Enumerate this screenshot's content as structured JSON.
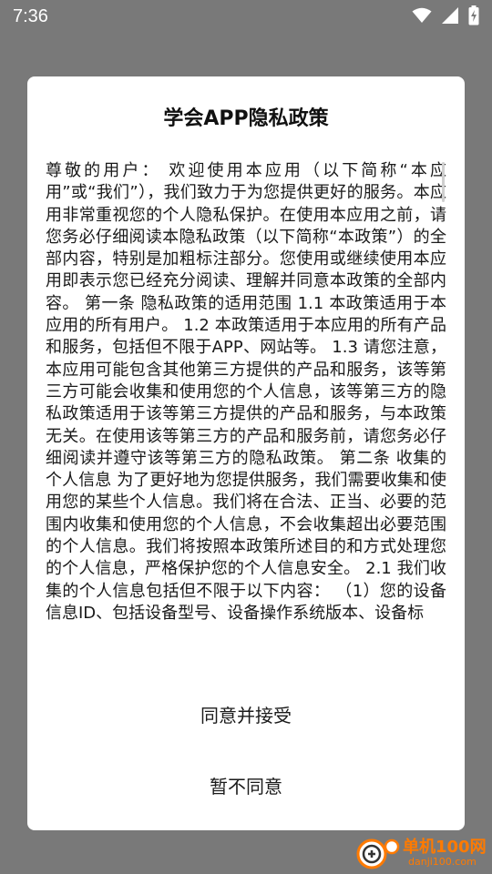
{
  "status_bar": {
    "time": "7:36",
    "icons": [
      "wifi-icon",
      "signal-icon",
      "battery-charging-icon"
    ]
  },
  "dialog": {
    "title": "学会APP隐私政策",
    "content": "尊敬的用户： 欢迎使用本应用（以下简称“本应用”或“我们”），我们致力于为您提供更好的服务。本应用非常重视您的个人隐私保护。在使用本应用之前，请您务必仔细阅读本隐私政策（以下简称“本政策”）的全部内容，特别是加粗标注部分。您使用或继续使用本应用即表示您已经充分阅读、理解并同意本政策的全部内容。 第一条 隐私政策的适用范围 1.1 本政策适用于本应用的所有用户。 1.2 本政策适用于本应用的所有产品和服务，包括但不限于APP、网站等。 1.3 请您注意，本应用可能包含其他第三方提供的产品和服务，该等第三方可能会收集和使用您的个人信息，该等第三方的隐私政策适用于该等第三方提供的产品和服务，与本政策无关。在使用该等第三方的产品和服务前，请您务必仔细阅读并遵守该等第三方的隐私政策。 第二条 收集的个人信息 为了更好地为您提供服务，我们需要收集和使用您的某些个人信息。我们将在合法、正当、必要的范围内收集和使用您的个人信息，不会收集超出必要范围的个人信息。我们将按照本政策所述目的和方式处理您的个人信息，严格保护您的个人信息安全。 2.1 我们收集的个人信息包括但不限于以下内容： （1）您的设备信息ID、包括设备型号、设备操作系统版本、设备标",
    "agree_label": "同意并接受",
    "decline_label": "暂不同意"
  },
  "watermark": {
    "name": "单机100网",
    "url": "danji100.com"
  },
  "colors": {
    "backdrop": "#797979",
    "dialog_bg": "#ffffff",
    "watermark": "#ff7a00"
  }
}
